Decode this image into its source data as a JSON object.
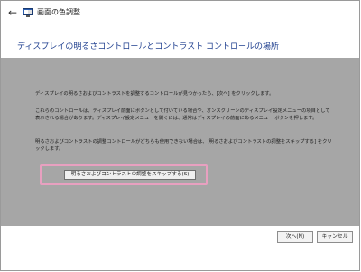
{
  "window": {
    "title": "画面の色調整",
    "back_icon": "←"
  },
  "header": {
    "title": "ディスプレイの明るさコントロールとコントラスト コントロールの場所"
  },
  "main": {
    "paragraph1": "ディスプレイの明るさおよびコントラストを調整するコントロールが見つかったら、[次へ] をクリックします。",
    "paragraph2": "これらのコントロールは、ディスプレイ前面にボタンとして付いている場合や、オンスクリーンのディスプレイ設定メニューの項目として表示される場合があります。ディスプレイ設定メニューを開くには、通常はディスプレイの前面にあるメニュー ボタンを押します。",
    "paragraph3": "明るさおよびコントラストの調整コントロールがどちらも使用できない場合は、[明るさおよびコントラストの調整をスキップする] をクリックします。",
    "skip_button": "明るさおよびコントラストの調整をスキップする(S)"
  },
  "footer": {
    "next_button": "次へ(N)",
    "cancel_button": "キャンセル"
  },
  "colors": {
    "content_bg": "#a6a6a6",
    "title_color": "#1f3f8f",
    "highlight": "#e8a0c0"
  }
}
